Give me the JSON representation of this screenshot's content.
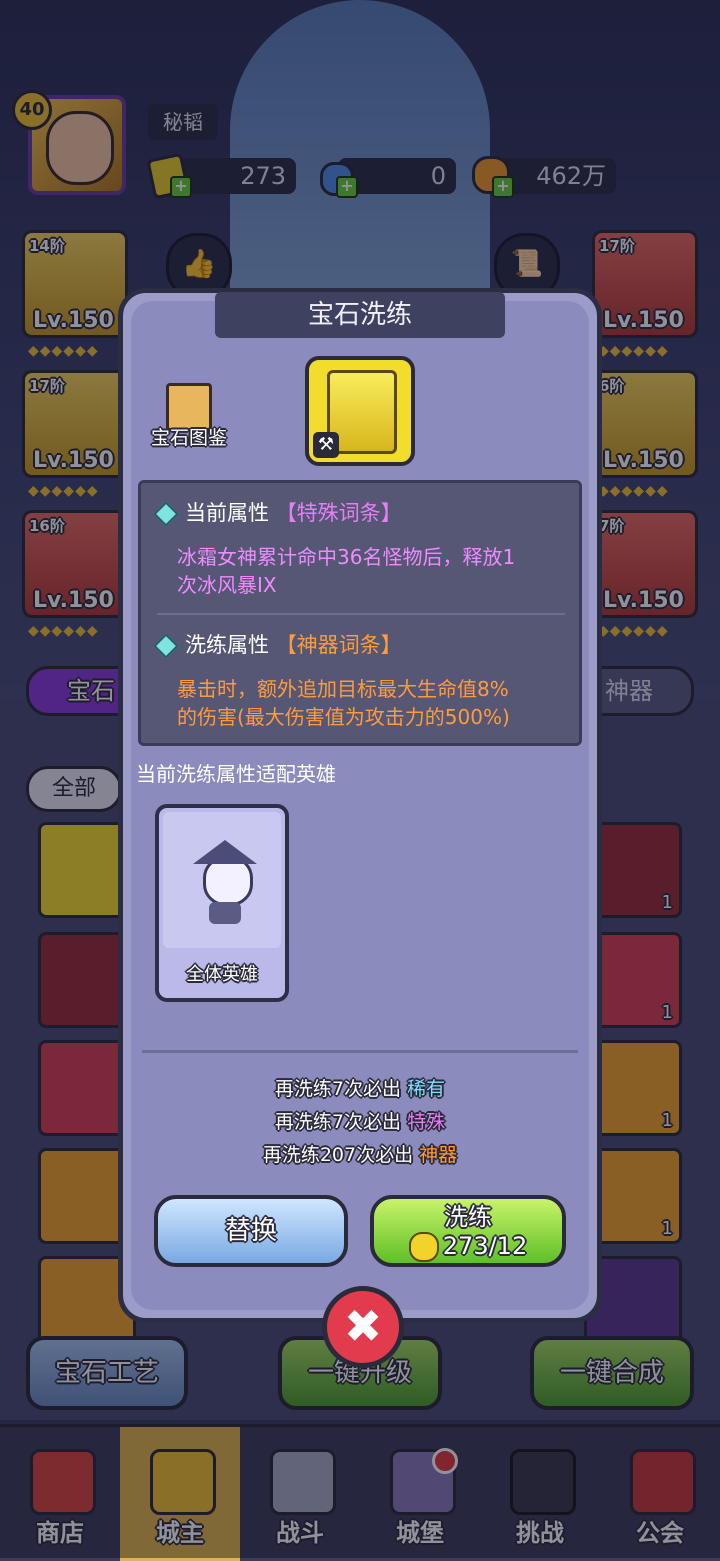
{
  "header": {
    "level": "40",
    "player_name": "秘韬",
    "gems": "273",
    "potion": "0",
    "gold": "462万"
  },
  "slots": {
    "left": [
      {
        "tier": "14阶",
        "level": "Lv.150"
      },
      {
        "tier": "17阶",
        "level": "Lv.150"
      },
      {
        "tier": "16阶",
        "level": "Lv.150"
      }
    ],
    "right": [
      {
        "tier": "17阶",
        "level": "Lv.150"
      },
      {
        "tier": "6阶",
        "level": "Lv.150"
      },
      {
        "tier": "7阶",
        "level": "Lv.150"
      }
    ]
  },
  "tabs": {
    "gem": "宝石",
    "artifact": "神器",
    "all": "全部"
  },
  "grid_counts": [
    "1",
    "1",
    "1",
    "1"
  ],
  "modal": {
    "title": "宝石洗练",
    "codex_label": "宝石图鉴",
    "current_attr_label": "当前属性",
    "current_attr_tag": "【特殊词条】",
    "current_attr_text_line1": "冰霜女神累计命中36名怪物后，释放1",
    "current_attr_text_line2": "次冰风暴IX",
    "refine_attr_label": "洗练属性",
    "refine_attr_tag": "【神器词条】",
    "refine_attr_text_line1": "暴击时，额外追加目标最大生命值8%",
    "refine_attr_text_line2": "的伤害(最大伤害值为攻击力的500%)",
    "fit_label": "当前洗练属性适配英雄",
    "hero_label": "全体英雄",
    "pity": [
      {
        "prefix": "再洗练7次必出",
        "tier": "稀有"
      },
      {
        "prefix": "再洗练7次必出",
        "tier": "特殊"
      },
      {
        "prefix": "再洗练207次必出",
        "tier": "神器"
      }
    ],
    "replace_button": "替换",
    "refine_button": "洗练",
    "refine_cost": "273/12",
    "close_symbol": "✖"
  },
  "bottom_buttons": {
    "craft": "宝石工艺",
    "upgrade": "一键升级",
    "merge": "一键合成"
  },
  "nav": [
    "商店",
    "城主",
    "战斗",
    "城堡",
    "挑战",
    "公会"
  ],
  "colors": {
    "special": "#e67ef6",
    "artifact": "#ff9b3d",
    "rare": "#7fdfff",
    "nav_active": "#e0b64a"
  }
}
